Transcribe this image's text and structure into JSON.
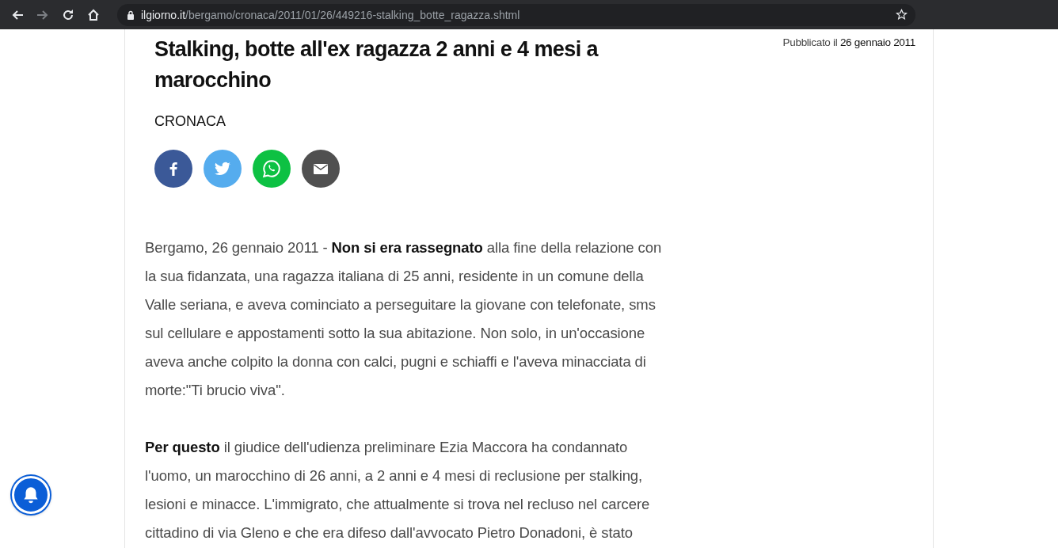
{
  "browser": {
    "forward": {
      "disabled": true
    },
    "url": {
      "domain": "ilgiorno.it",
      "path": "/bergamo/cronaca/2011/01/26/449216-stalking_botte_ragazza.shtml"
    }
  },
  "article": {
    "title": "Stalking, botte all'ex ragazza 2 anni e 4 mesi a marocchino",
    "published": {
      "label": "Pubblicato il",
      "date": "26 gennaio 2011"
    },
    "section": "CRONACA",
    "share": [
      {
        "kind": "facebook",
        "color": "#3b5998"
      },
      {
        "kind": "twitter",
        "color": "#55acee"
      },
      {
        "kind": "whatsapp",
        "color": "#0dc143"
      },
      {
        "kind": "email",
        "color": "#505050"
      }
    ],
    "paragraphs": [
      "Bergamo, 26 gennaio 2011 - **Non si era rassegnato** alla fine della relazione con la sua fidanzata, una ragazza italiana di 25 anni, residente in un comune della Valle seriana, e aveva cominciato a perseguitare la giovane con telefonate, sms sul cellulare e appostamenti sotto la sua abitazione. Non solo, in un'occasione aveva anche colpito la donna con calci, pugni e schiaffi e l'aveva minacciata di morte:\"Ti brucio viva\".",
      "**Per questo** il giudice dell'udienza preliminare Ezia Maccora ha condannato l'uomo, un marocchino di 26 anni, a 2 anni e 4 mesi di reclusione per stalking, lesioni e minacce. L'immigrato, che attualmente si trova nel recluso nel carcere cittadino di via Gleno e che era difeso dall'avvocato Pietro Donadoni, è stato"
    ]
  }
}
